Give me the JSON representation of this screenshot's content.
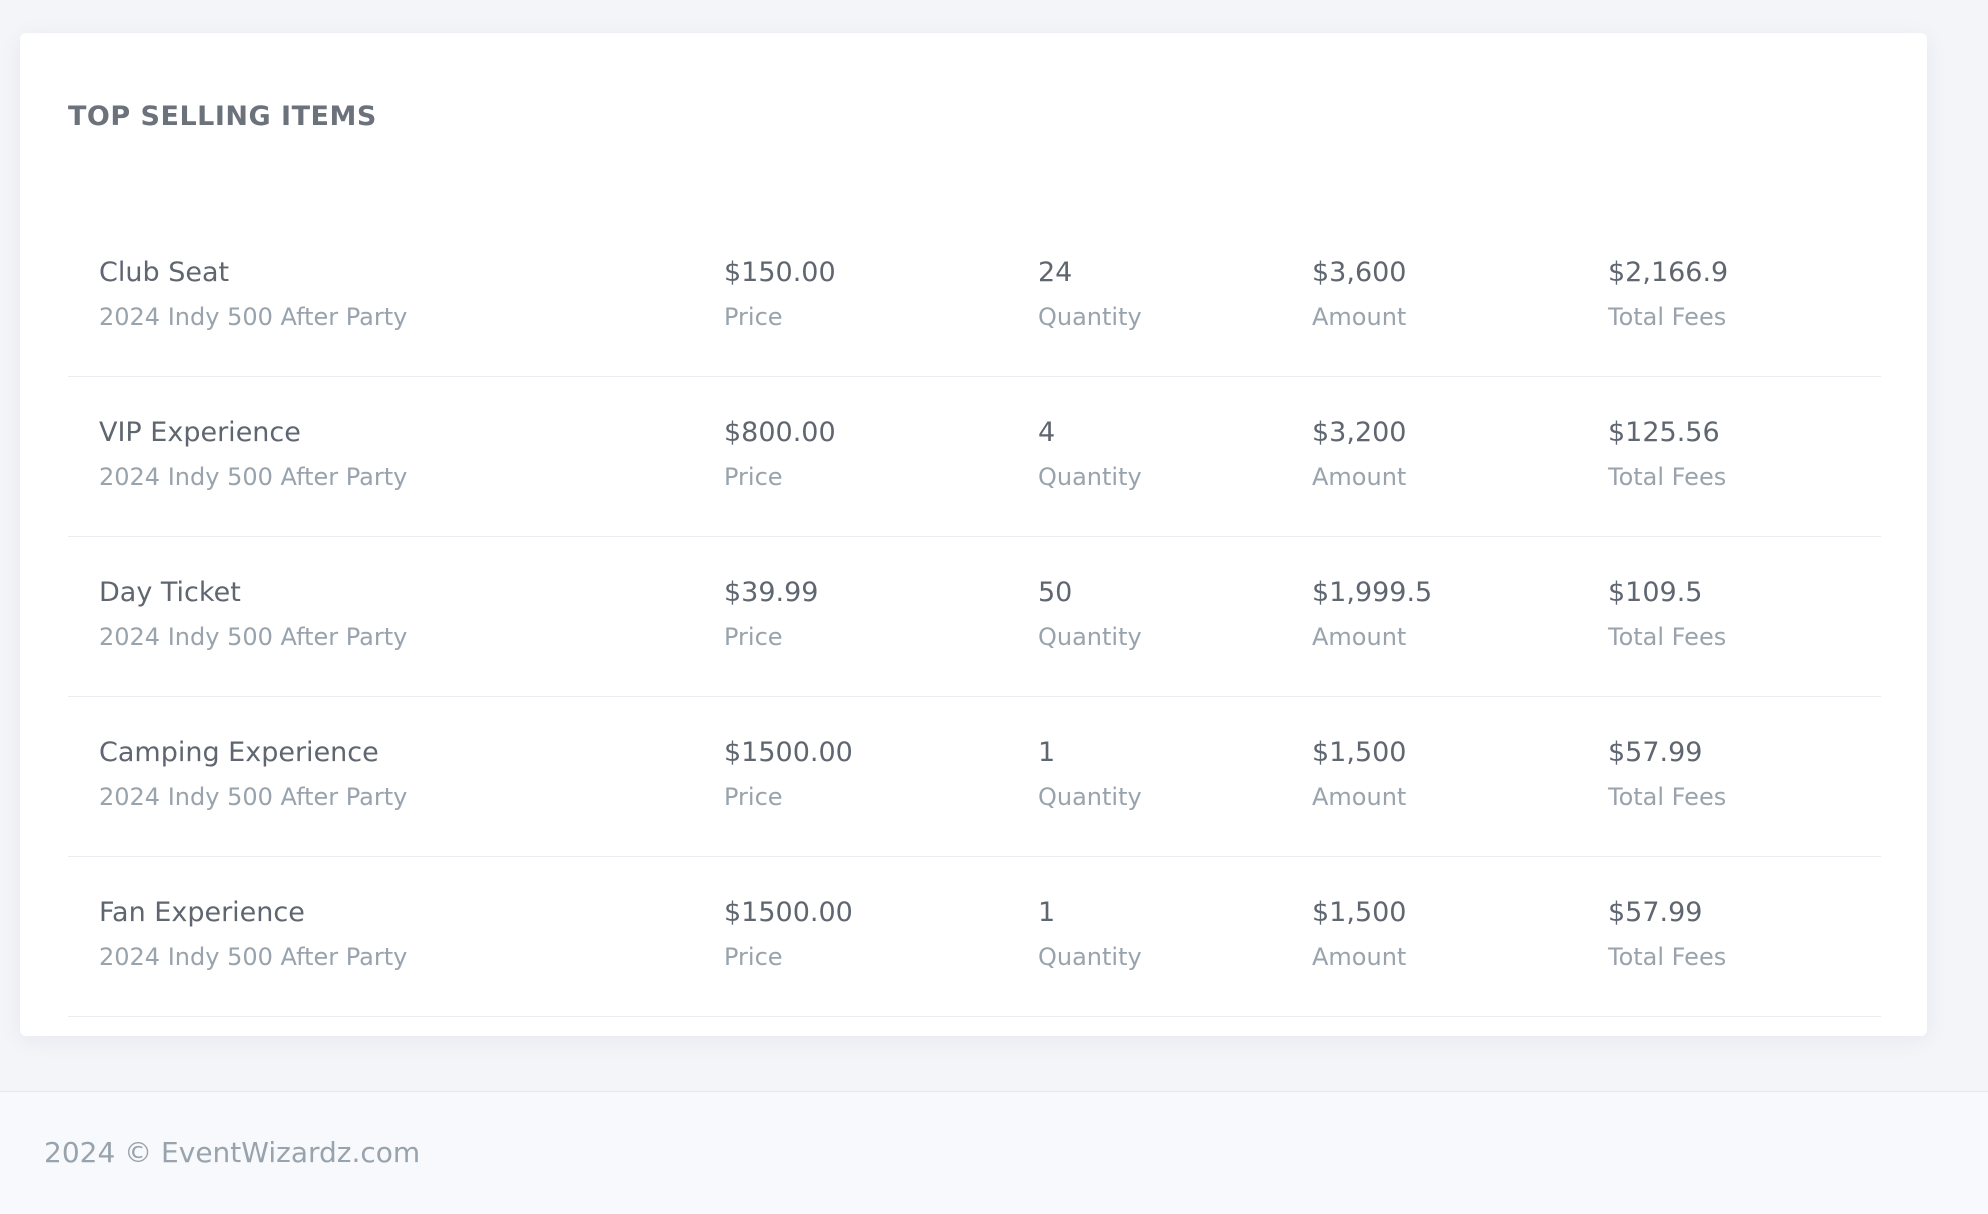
{
  "card": {
    "title": "TOP SELLING ITEMS"
  },
  "items": [
    {
      "name": "Club Seat",
      "event": "2024 Indy 500 After Party",
      "price": "$150.00",
      "price_label": "Price",
      "quantity": "24",
      "quantity_label": "Quantity",
      "amount": "$3,600",
      "amount_label": "Amount",
      "fees": "$2,166.9",
      "fees_label": "Total Fees"
    },
    {
      "name": "VIP Experience",
      "event": "2024 Indy 500 After Party",
      "price": "$800.00",
      "price_label": "Price",
      "quantity": "4",
      "quantity_label": "Quantity",
      "amount": "$3,200",
      "amount_label": "Amount",
      "fees": "$125.56",
      "fees_label": "Total Fees"
    },
    {
      "name": "Day Ticket",
      "event": "2024 Indy 500 After Party",
      "price": "$39.99",
      "price_label": "Price",
      "quantity": "50",
      "quantity_label": "Quantity",
      "amount": "$1,999.5",
      "amount_label": "Amount",
      "fees": "$109.5",
      "fees_label": "Total Fees"
    },
    {
      "name": "Camping Experience",
      "event": "2024 Indy 500 After Party",
      "price": "$1500.00",
      "price_label": "Price",
      "quantity": "1",
      "quantity_label": "Quantity",
      "amount": "$1,500",
      "amount_label": "Amount",
      "fees": "$57.99",
      "fees_label": "Total Fees"
    },
    {
      "name": "Fan Experience",
      "event": "2024 Indy 500 After Party",
      "price": "$1500.00",
      "price_label": "Price",
      "quantity": "1",
      "quantity_label": "Quantity",
      "amount": "$1,500",
      "amount_label": "Amount",
      "fees": "$57.99",
      "fees_label": "Total Fees"
    }
  ],
  "footer": {
    "text": "2024 © EventWizardz.com"
  },
  "colors": {
    "page_background": "#f3f5f9",
    "card_background": "#ffffff",
    "primary_text": "#5f6670",
    "muted_text": "#98a3ad",
    "divider": "#e9ecf0"
  }
}
